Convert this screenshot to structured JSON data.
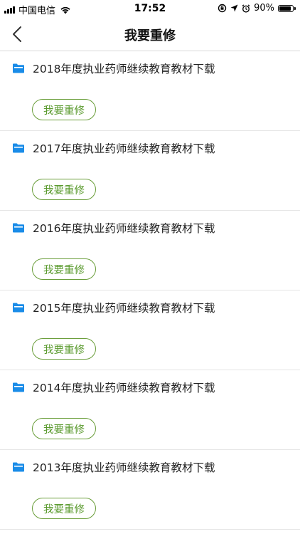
{
  "status_bar": {
    "carrier": "中国电信",
    "time": "17:52",
    "battery": "90%",
    "battery_level": 0.9
  },
  "nav": {
    "back_icon": "chevron-left-icon",
    "title": "我要重修"
  },
  "colors": {
    "accent_green": "#5a9a2e",
    "folder_blue": "#1a8ce8"
  },
  "items": [
    {
      "title": "2018年度执业药师继续教育教材下载",
      "button_label": "我要重修"
    },
    {
      "title": "2017年度执业药师继续教育教材下载",
      "button_label": "我要重修"
    },
    {
      "title": "2016年度执业药师继续教育教材下载",
      "button_label": "我要重修"
    },
    {
      "title": "2015年度执业药师继续教育教材下载",
      "button_label": "我要重修"
    },
    {
      "title": "2014年度执业药师继续教育教材下载",
      "button_label": "我要重修"
    },
    {
      "title": "2013年度执业药师继续教育教材下载",
      "button_label": "我要重修"
    }
  ]
}
